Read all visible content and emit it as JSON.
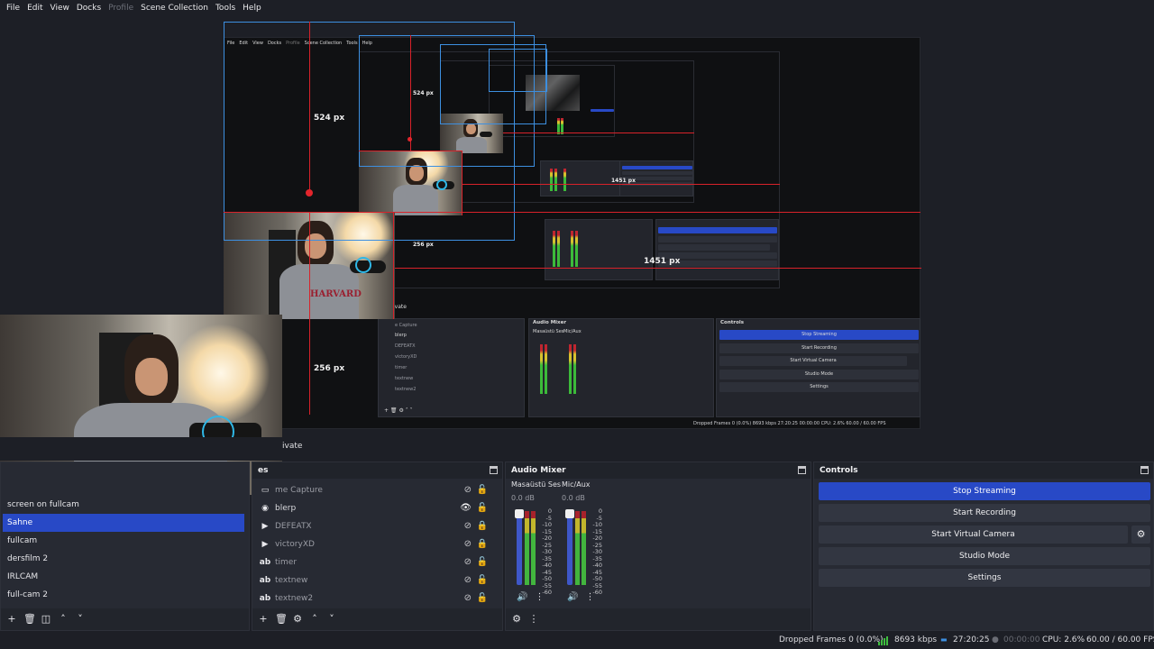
{
  "menubar": {
    "items": [
      "File",
      "Edit",
      "View",
      "Docks",
      "Profile",
      "Scene Collection",
      "Tools",
      "Help"
    ]
  },
  "preview": {
    "measurements": {
      "outer_height": "524 px",
      "outer_width": "1451 px",
      "cam_height": "256 px",
      "inner_height": "524 px",
      "inner_width": "1451 px",
      "inner_cam": "256 px"
    },
    "nested_private": "ivate",
    "nested_controls_title": "Controls",
    "nested_mixer_title": "Audio Mixer",
    "nested_buttons": [
      "Stop Streaming",
      "Start Recording",
      "Start Virtual Camera",
      "Studio Mode",
      "Settings"
    ],
    "nested_sources": [
      "e Capture",
      "blerp",
      "DEFEATX",
      "victoryXD",
      "timer",
      "textnew",
      "textnew2"
    ],
    "nested_mixer_channels": [
      "Masaüstü Ses",
      "Mic/Aux"
    ],
    "nested_status": "Dropped Frames 0 (0.0%)   8693 kbps   27:20:25   00:00:00   CPU: 2.6%   60.00 / 60.00 FPS"
  },
  "modebar": {
    "private_label": "ivate"
  },
  "scenes": {
    "title": "",
    "items": [
      {
        "label": "screen on fullcam",
        "active": false
      },
      {
        "label": "Sahne",
        "active": true
      },
      {
        "label": "fullcam",
        "active": false
      },
      {
        "label": "dersfilm 2",
        "active": false
      },
      {
        "label": "IRLCAM",
        "active": false
      },
      {
        "label": "full-cam 2",
        "active": false
      }
    ]
  },
  "sources": {
    "title": "es",
    "items": [
      {
        "icon": "window-capture-icon",
        "label": "me Capture",
        "visible": false,
        "locked": false
      },
      {
        "icon": "globe-icon",
        "label": "blerp",
        "visible": true,
        "locked": false
      },
      {
        "icon": "media-play-icon",
        "label": "DEFEATX",
        "visible": false,
        "locked": true
      },
      {
        "icon": "media-play-icon",
        "label": "victoryXD",
        "visible": false,
        "locked": true
      },
      {
        "icon": "text-icon",
        "label": "timer",
        "visible": false,
        "locked": false
      },
      {
        "icon": "text-icon",
        "label": "textnew",
        "visible": false,
        "locked": false
      },
      {
        "icon": "text-icon",
        "label": "textnew2",
        "visible": false,
        "locked": false
      }
    ]
  },
  "mixer": {
    "title": "Audio Mixer",
    "channels": [
      {
        "name": "Masaüstü Ses",
        "db": "0.0 dB",
        "level": 1.0
      },
      {
        "name": "Mic/Aux",
        "db": "0.0 dB",
        "level": 1.0
      }
    ],
    "scale": [
      "0",
      "-5",
      "-10",
      "-15",
      "-20",
      "-25",
      "-30",
      "-35",
      "-40",
      "-45",
      "-50",
      "-55",
      "-60"
    ]
  },
  "controls": {
    "title": "Controls",
    "stop_streaming": "Stop Streaming",
    "start_recording": "Start Recording",
    "start_virtual_camera": "Start Virtual Camera",
    "studio_mode": "Studio Mode",
    "settings": "Settings"
  },
  "statusbar": {
    "dropped_frames": "Dropped Frames 0 (0.0%)",
    "bitrate": "8693 kbps",
    "stream_time": "27:20:25",
    "record_time": "00:00:00",
    "cpu": "CPU: 2.6%",
    "fps": "60.00 / 60.00 FPS"
  },
  "colors": {
    "accent": "#2849c6",
    "background": "#1d1f26",
    "panel": "#272a33",
    "guide_red": "#d8222a",
    "guide_blue": "#3d8fe0",
    "meter_green": "#42b53e"
  }
}
